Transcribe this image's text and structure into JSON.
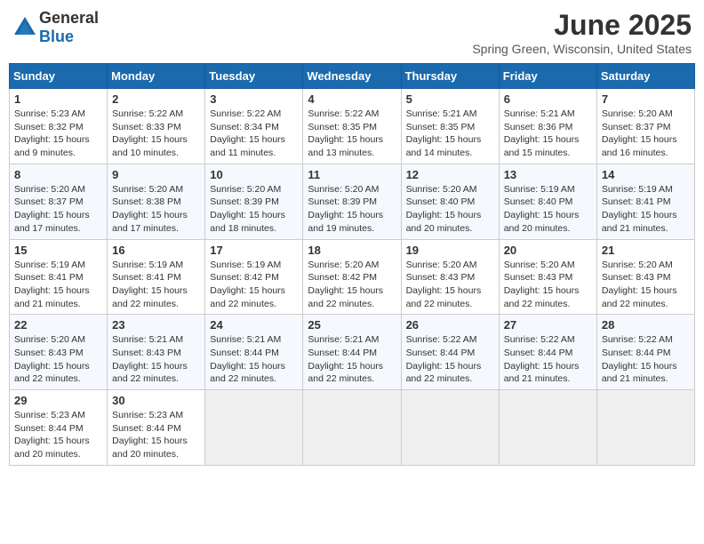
{
  "header": {
    "logo_general": "General",
    "logo_blue": "Blue",
    "month": "June 2025",
    "location": "Spring Green, Wisconsin, United States"
  },
  "days_of_week": [
    "Sunday",
    "Monday",
    "Tuesday",
    "Wednesday",
    "Thursday",
    "Friday",
    "Saturday"
  ],
  "weeks": [
    [
      {
        "day": "1",
        "sunrise": "5:23 AM",
        "sunset": "8:32 PM",
        "daylight": "15 hours and 9 minutes."
      },
      {
        "day": "2",
        "sunrise": "5:22 AM",
        "sunset": "8:33 PM",
        "daylight": "15 hours and 10 minutes."
      },
      {
        "day": "3",
        "sunrise": "5:22 AM",
        "sunset": "8:34 PM",
        "daylight": "15 hours and 11 minutes."
      },
      {
        "day": "4",
        "sunrise": "5:22 AM",
        "sunset": "8:35 PM",
        "daylight": "15 hours and 13 minutes."
      },
      {
        "day": "5",
        "sunrise": "5:21 AM",
        "sunset": "8:35 PM",
        "daylight": "15 hours and 14 minutes."
      },
      {
        "day": "6",
        "sunrise": "5:21 AM",
        "sunset": "8:36 PM",
        "daylight": "15 hours and 15 minutes."
      },
      {
        "day": "7",
        "sunrise": "5:20 AM",
        "sunset": "8:37 PM",
        "daylight": "15 hours and 16 minutes."
      }
    ],
    [
      {
        "day": "8",
        "sunrise": "5:20 AM",
        "sunset": "8:37 PM",
        "daylight": "15 hours and 17 minutes."
      },
      {
        "day": "9",
        "sunrise": "5:20 AM",
        "sunset": "8:38 PM",
        "daylight": "15 hours and 17 minutes."
      },
      {
        "day": "10",
        "sunrise": "5:20 AM",
        "sunset": "8:39 PM",
        "daylight": "15 hours and 18 minutes."
      },
      {
        "day": "11",
        "sunrise": "5:20 AM",
        "sunset": "8:39 PM",
        "daylight": "15 hours and 19 minutes."
      },
      {
        "day": "12",
        "sunrise": "5:20 AM",
        "sunset": "8:40 PM",
        "daylight": "15 hours and 20 minutes."
      },
      {
        "day": "13",
        "sunrise": "5:19 AM",
        "sunset": "8:40 PM",
        "daylight": "15 hours and 20 minutes."
      },
      {
        "day": "14",
        "sunrise": "5:19 AM",
        "sunset": "8:41 PM",
        "daylight": "15 hours and 21 minutes."
      }
    ],
    [
      {
        "day": "15",
        "sunrise": "5:19 AM",
        "sunset": "8:41 PM",
        "daylight": "15 hours and 21 minutes."
      },
      {
        "day": "16",
        "sunrise": "5:19 AM",
        "sunset": "8:41 PM",
        "daylight": "15 hours and 22 minutes."
      },
      {
        "day": "17",
        "sunrise": "5:19 AM",
        "sunset": "8:42 PM",
        "daylight": "15 hours and 22 minutes."
      },
      {
        "day": "18",
        "sunrise": "5:20 AM",
        "sunset": "8:42 PM",
        "daylight": "15 hours and 22 minutes."
      },
      {
        "day": "19",
        "sunrise": "5:20 AM",
        "sunset": "8:43 PM",
        "daylight": "15 hours and 22 minutes."
      },
      {
        "day": "20",
        "sunrise": "5:20 AM",
        "sunset": "8:43 PM",
        "daylight": "15 hours and 22 minutes."
      },
      {
        "day": "21",
        "sunrise": "5:20 AM",
        "sunset": "8:43 PM",
        "daylight": "15 hours and 22 minutes."
      }
    ],
    [
      {
        "day": "22",
        "sunrise": "5:20 AM",
        "sunset": "8:43 PM",
        "daylight": "15 hours and 22 minutes."
      },
      {
        "day": "23",
        "sunrise": "5:21 AM",
        "sunset": "8:43 PM",
        "daylight": "15 hours and 22 minutes."
      },
      {
        "day": "24",
        "sunrise": "5:21 AM",
        "sunset": "8:44 PM",
        "daylight": "15 hours and 22 minutes."
      },
      {
        "day": "25",
        "sunrise": "5:21 AM",
        "sunset": "8:44 PM",
        "daylight": "15 hours and 22 minutes."
      },
      {
        "day": "26",
        "sunrise": "5:22 AM",
        "sunset": "8:44 PM",
        "daylight": "15 hours and 22 minutes."
      },
      {
        "day": "27",
        "sunrise": "5:22 AM",
        "sunset": "8:44 PM",
        "daylight": "15 hours and 21 minutes."
      },
      {
        "day": "28",
        "sunrise": "5:22 AM",
        "sunset": "8:44 PM",
        "daylight": "15 hours and 21 minutes."
      }
    ],
    [
      {
        "day": "29",
        "sunrise": "5:23 AM",
        "sunset": "8:44 PM",
        "daylight": "15 hours and 20 minutes."
      },
      {
        "day": "30",
        "sunrise": "5:23 AM",
        "sunset": "8:44 PM",
        "daylight": "15 hours and 20 minutes."
      },
      null,
      null,
      null,
      null,
      null
    ]
  ]
}
